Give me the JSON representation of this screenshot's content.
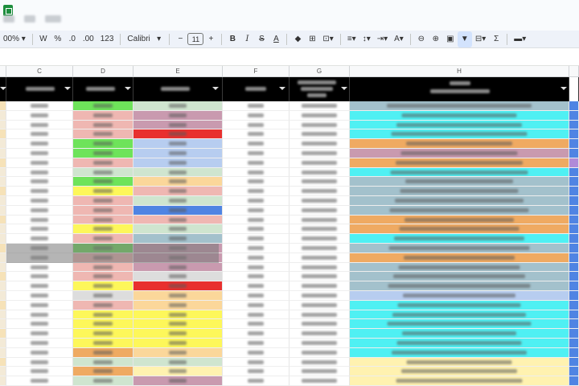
{
  "window": {
    "logo": "sheets-logo-icon",
    "menu_items": [
      "",
      "",
      ""
    ]
  },
  "toolbar": {
    "zoom": "00%",
    "format_w": "W",
    "percent": "%",
    "dec_decrease": ".0",
    "dec_increase": ".00",
    "number_format": "123",
    "font_name": "Calibri",
    "minus": "−",
    "font_size": "11",
    "plus": "+",
    "bold": "B",
    "italic": "I",
    "strike": "S",
    "text_color": "A",
    "text_color2": "A",
    "sum": "Σ",
    "icons": [
      "fill-color-icon",
      "borders-icon",
      "merge-icon",
      "align-icon",
      "valign-icon",
      "wrap-icon",
      "rotate-icon",
      "link-icon",
      "comment-icon",
      "chart-icon",
      "filter-icon",
      "filter-views-icon",
      "functions-icon",
      "input-tools-icon"
    ]
  },
  "columns": [
    "C",
    "D",
    "E",
    "F",
    "G",
    "H"
  ],
  "colors": {
    "green": "#6ee35a",
    "pink": "#efb7b2",
    "red": "#e8302e",
    "lightblue": "#b7cdf0",
    "blue": "#4f84e3",
    "yellow": "#fdf75a",
    "orange": "#efaa62",
    "peach": "#fbd79a",
    "mauve": "#c99aaf",
    "cyan": "#4ff0f3",
    "greyblue": "#a3c1cc",
    "mint": "#cfe5cf",
    "lightyellow": "#fff2b0",
    "purple": "#b08ad8",
    "grey": "#dddddd",
    "black": "#000000"
  },
  "rows": [
    {
      "d": "green",
      "e": "mint",
      "h": "greyblue",
      "s": "blue"
    },
    {
      "d": "pink",
      "e": "mauve",
      "h": "cyan",
      "s": "blue"
    },
    {
      "d": "pink",
      "e": "mauve",
      "h": "cyan",
      "s": "blue"
    },
    {
      "d": "pink",
      "e": "red",
      "h": "cyan",
      "s": "blue"
    },
    {
      "d": "green",
      "e": "lightblue",
      "h": "orange",
      "s": "blue"
    },
    {
      "d": "green",
      "e": "lightblue",
      "h": "mauve",
      "s": "blue"
    },
    {
      "d": "pink",
      "e": "lightblue",
      "h": "orange",
      "s": "purple"
    },
    {
      "d": "mint",
      "e": "mint",
      "h": "cyan",
      "s": "blue"
    },
    {
      "d": "green",
      "e": "peach",
      "h": "greyblue",
      "s": "blue"
    },
    {
      "d": "yellow",
      "e": "pink",
      "h": "greyblue",
      "s": "blue"
    },
    {
      "d": "pink",
      "e": "mint",
      "h": "greyblue",
      "s": "blue"
    },
    {
      "d": "pink",
      "e": "blue",
      "h": "greyblue",
      "s": "blue"
    },
    {
      "d": "pink",
      "e": "pink",
      "h": "orange",
      "s": "blue"
    },
    {
      "d": "yellow",
      "e": "mint",
      "h": "orange",
      "s": "blue"
    },
    {
      "d": "pink",
      "e": "greyblue",
      "h": "cyan",
      "s": "blue"
    },
    {
      "d": "green",
      "e": "mauve",
      "h": "greyblue",
      "s": "blue"
    },
    {
      "d": "pink",
      "e": "mauve",
      "h": "orange",
      "s": "blue"
    },
    {
      "d": "pink",
      "e": "mauve",
      "h": "greyblue",
      "s": "blue"
    },
    {
      "d": "pink",
      "e": "grey",
      "h": "greyblue",
      "s": "blue"
    },
    {
      "d": "yellow",
      "e": "red",
      "h": "greyblue",
      "s": "blue"
    },
    {
      "d": "grey",
      "e": "peach",
      "h": "lightblue",
      "s": "blue"
    },
    {
      "d": "pink",
      "e": "peach",
      "h": "cyan",
      "s": "blue"
    },
    {
      "d": "yellow",
      "e": "yellow",
      "h": "cyan",
      "s": "blue"
    },
    {
      "d": "yellow",
      "e": "yellow",
      "h": "cyan",
      "s": "blue"
    },
    {
      "d": "yellow",
      "e": "yellow",
      "h": "cyan",
      "s": "blue"
    },
    {
      "d": "yellow",
      "e": "yellow",
      "h": "cyan",
      "s": "blue"
    },
    {
      "d": "orange",
      "e": "peach",
      "h": "cyan",
      "s": "blue"
    },
    {
      "d": "mint",
      "e": "mint",
      "h": "lightyellow",
      "s": "blue"
    },
    {
      "d": "orange",
      "e": "lightyellow",
      "h": "lightyellow",
      "s": "blue"
    },
    {
      "d": "mint",
      "e": "mauve",
      "h": "lightyellow",
      "s": "blue"
    }
  ]
}
